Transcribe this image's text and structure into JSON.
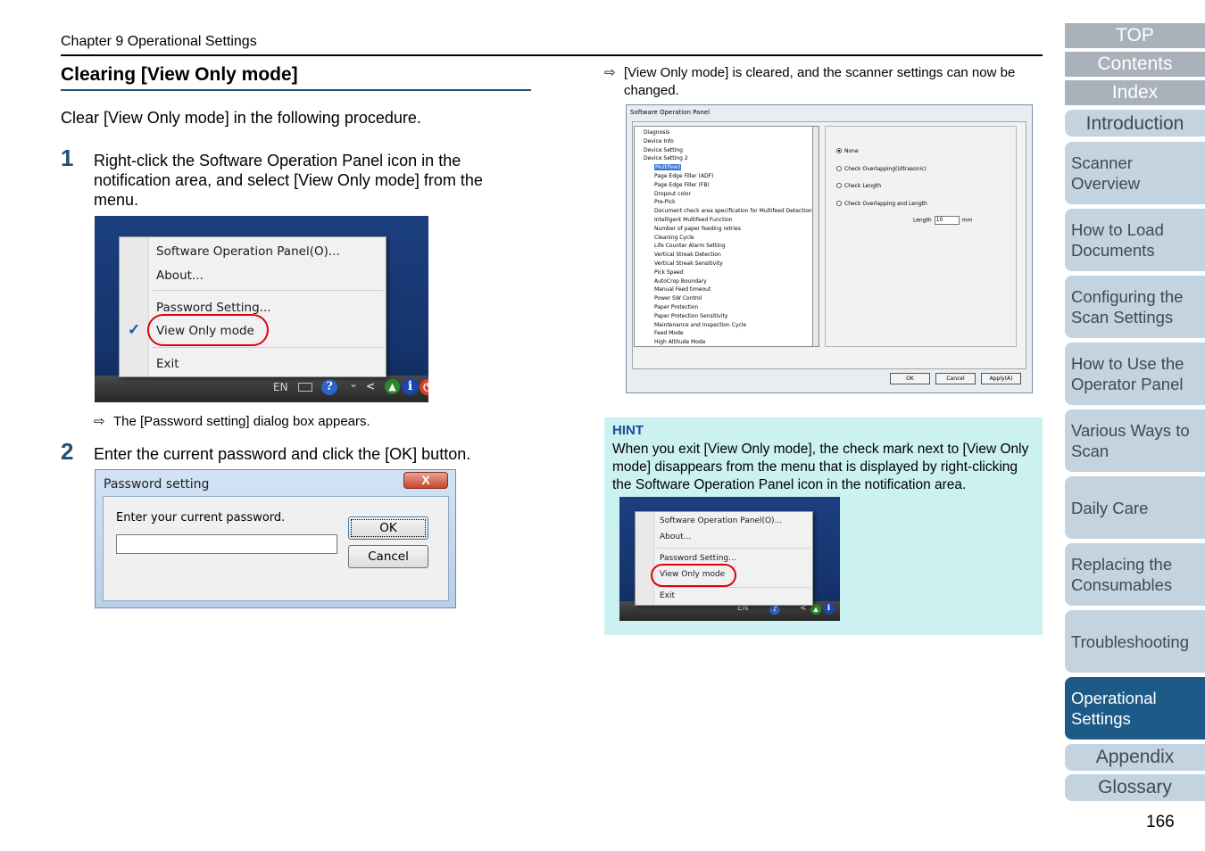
{
  "header": {
    "chapter": "Chapter 9 Operational Settings"
  },
  "section": {
    "title": "Clearing [View Only mode]",
    "intro": "Clear [View Only mode] in the following procedure."
  },
  "steps": [
    {
      "number": "1",
      "text": "Right-click the Software Operation Panel icon in the notification area, and select [View Only mode] from the menu.",
      "result": "The [Password setting] dialog box appears."
    },
    {
      "number": "2",
      "text": "Enter the current password and click the [OK] button.",
      "result": "[View Only mode] is cleared, and the scanner settings can now be changed."
    }
  ],
  "result_arrow": "⇨",
  "context_menu": {
    "items": [
      "Software Operation Panel(O)...",
      "About...",
      "Password Setting...",
      "View Only mode",
      "Exit"
    ],
    "checkmark": "✓",
    "tray": {
      "lang": "EN",
      "help": "?",
      "info": "i",
      "chevron": "<"
    }
  },
  "password_dialog": {
    "title": "Password setting",
    "close": "X",
    "prompt": "Enter your current password.",
    "ok": "OK",
    "cancel": "Cancel"
  },
  "sop_window": {
    "title": "Software Operation Panel",
    "tree": [
      "Diagnosis",
      "Device Info",
      "Device Setting",
      "Device Setting 2",
      "Multifeed",
      "Page Edge Filler (ADF)",
      "Page Edge Filler (FB)",
      "Dropout color",
      "Pre-Pick",
      "Document check area specification for Multifeed Detection",
      "Intelligent Multifeed Function",
      "Number of paper feeding retries",
      "Cleaning Cycle",
      "Life Counter Alarm Setting",
      "Vertical Streak Detection",
      "Vertical Streak Sensitivity",
      "Pick Speed",
      "AutoCrop Boundary",
      "Manual Feed timeout",
      "Power SW Control",
      "Paper Protection",
      "Paper Protection Sensitivity",
      "Maintenance and Inspection Cycle",
      "Feed Mode",
      "High Altitude Mode"
    ],
    "options": [
      "None",
      "Check Overlapping(Ultrasonic)",
      "Check Length",
      "Check Overlapping and Length"
    ],
    "length_label": "Length",
    "length_value": "10",
    "length_unit": "mm",
    "buttons": [
      "OK",
      "Cancel",
      "Apply(A)"
    ]
  },
  "hint": {
    "label": "HINT",
    "text": "When you exit [View Only mode], the check mark next to [View Only mode] disappears from the menu that is displayed by right-clicking the Software Operation Panel icon in the notification area."
  },
  "nav": {
    "top": "TOP",
    "contents": "Contents",
    "index": "Index",
    "items": [
      "Introduction",
      "Scanner Overview",
      "How to Load Documents",
      "Configuring the Scan Settings",
      "How to Use the Operator Panel",
      "Various Ways to Scan",
      "Daily Care",
      "Replacing the Consumables",
      "Troubleshooting",
      "Operational Settings"
    ],
    "appendix": "Appendix",
    "glossary": "Glossary"
  },
  "page_number": "166"
}
